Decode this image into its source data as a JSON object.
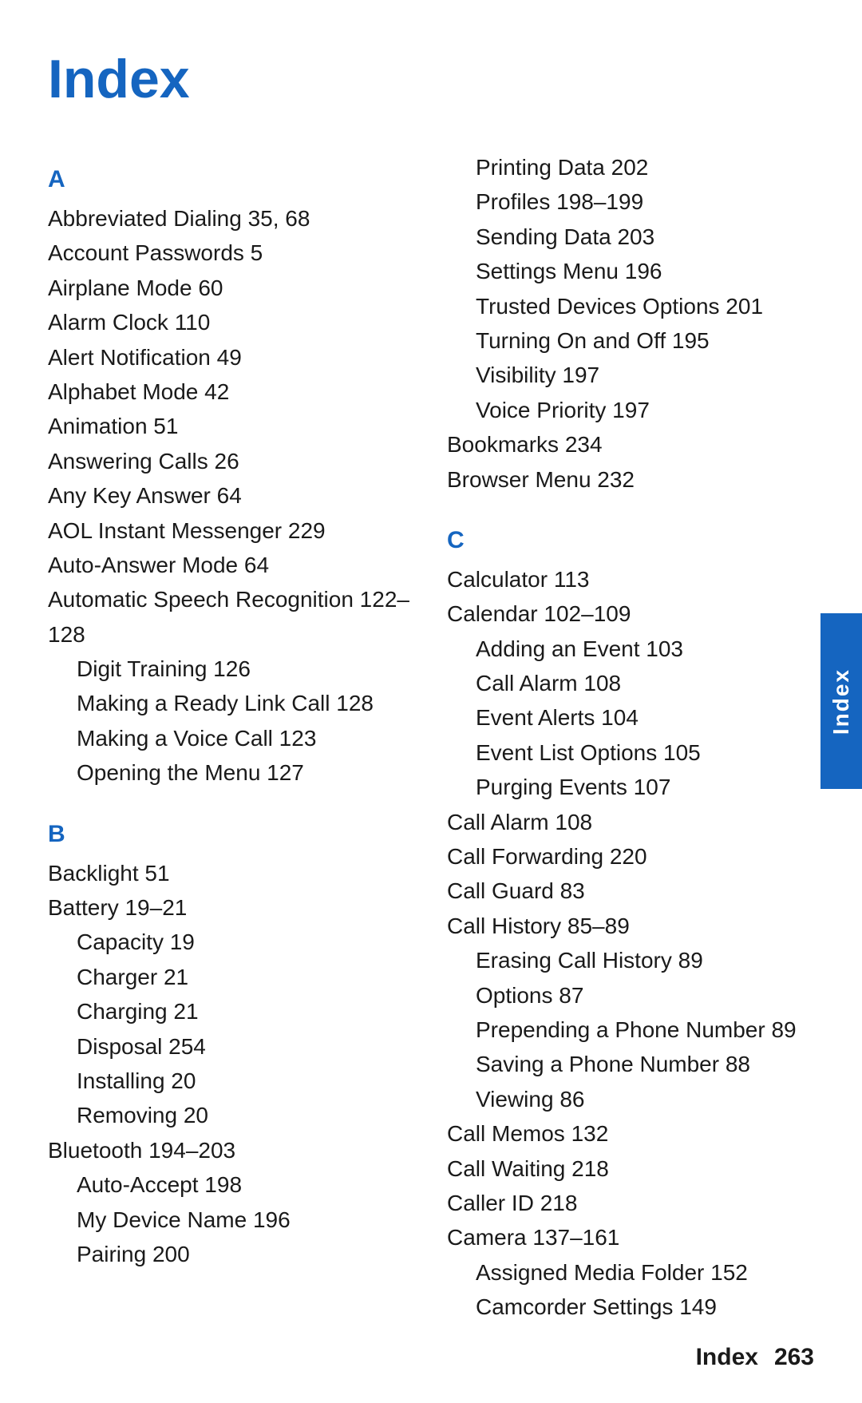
{
  "page": {
    "title": "Index",
    "footer_label": "Index",
    "footer_page": "263",
    "side_tab": "Index"
  },
  "left_column": {
    "sections": [
      {
        "letter": "A",
        "entries": [
          {
            "text": "Abbreviated Dialing  35, 68",
            "level": 0
          },
          {
            "text": "Account Passwords  5",
            "level": 0
          },
          {
            "text": "Airplane Mode  60",
            "level": 0
          },
          {
            "text": "Alarm Clock  110",
            "level": 0
          },
          {
            "text": "Alert Notification  49",
            "level": 0
          },
          {
            "text": "Alphabet Mode  42",
            "level": 0
          },
          {
            "text": "Animation  51",
            "level": 0
          },
          {
            "text": "Answering Calls  26",
            "level": 0
          },
          {
            "text": "Any Key Answer  64",
            "level": 0
          },
          {
            "text": "AOL Instant Messenger  229",
            "level": 0
          },
          {
            "text": "Auto-Answer Mode  64",
            "level": 0
          },
          {
            "text": "Automatic Speech Recognition  122–128",
            "level": 0
          },
          {
            "text": "Digit Training  126",
            "level": 1
          },
          {
            "text": "Making a Ready Link Call  128",
            "level": 1
          },
          {
            "text": "Making a Voice Call  123",
            "level": 1
          },
          {
            "text": "Opening the Menu  127",
            "level": 1
          }
        ]
      },
      {
        "letter": "B",
        "entries": [
          {
            "text": "Backlight  51",
            "level": 0
          },
          {
            "text": "Battery  19–21",
            "level": 0
          },
          {
            "text": "Capacity  19",
            "level": 1
          },
          {
            "text": "Charger  21",
            "level": 1
          },
          {
            "text": "Charging  21",
            "level": 1
          },
          {
            "text": "Disposal  254",
            "level": 1
          },
          {
            "text": "Installing  20",
            "level": 1
          },
          {
            "text": "Removing  20",
            "level": 1
          },
          {
            "text": "Bluetooth  194–203",
            "level": 0
          },
          {
            "text": "Auto-Accept  198",
            "level": 1
          },
          {
            "text": "My Device Name  196",
            "level": 1
          },
          {
            "text": "Pairing  200",
            "level": 1
          }
        ]
      }
    ]
  },
  "right_column": {
    "sections": [
      {
        "letter": "",
        "entries": [
          {
            "text": "Printing Data  202",
            "level": 1
          },
          {
            "text": "Profiles  198–199",
            "level": 1
          },
          {
            "text": "Sending Data  203",
            "level": 1
          },
          {
            "text": "Settings Menu  196",
            "level": 1
          },
          {
            "text": "Trusted Devices Options  201",
            "level": 1
          },
          {
            "text": "Turning On and Off  195",
            "level": 1
          },
          {
            "text": "Visibility  197",
            "level": 1
          },
          {
            "text": "Voice Priority  197",
            "level": 1
          },
          {
            "text": "Bookmarks  234",
            "level": 0
          },
          {
            "text": "Browser Menu  232",
            "level": 0
          }
        ]
      },
      {
        "letter": "C",
        "entries": [
          {
            "text": "Calculator  113",
            "level": 0
          },
          {
            "text": "Calendar  102–109",
            "level": 0
          },
          {
            "text": "Adding an Event  103",
            "level": 1
          },
          {
            "text": "Call Alarm  108",
            "level": 1
          },
          {
            "text": "Event Alerts  104",
            "level": 1
          },
          {
            "text": "Event List Options  105",
            "level": 1
          },
          {
            "text": "Purging Events  107",
            "level": 1
          },
          {
            "text": "Call Alarm  108",
            "level": 0
          },
          {
            "text": "Call Forwarding  220",
            "level": 0
          },
          {
            "text": "Call Guard  83",
            "level": 0
          },
          {
            "text": "Call History  85–89",
            "level": 0
          },
          {
            "text": "Erasing Call History  89",
            "level": 1
          },
          {
            "text": "Options  87",
            "level": 1
          },
          {
            "text": "Prepending a Phone Number  89",
            "level": 1
          },
          {
            "text": "Saving a Phone Number  88",
            "level": 1
          },
          {
            "text": "Viewing  86",
            "level": 1
          },
          {
            "text": "Call Memos  132",
            "level": 0
          },
          {
            "text": "Call Waiting  218",
            "level": 0
          },
          {
            "text": "Caller ID  218",
            "level": 0
          },
          {
            "text": "Camera  137–161",
            "level": 0
          },
          {
            "text": "Assigned Media Folder  152",
            "level": 1
          },
          {
            "text": "Camcorder Settings  149",
            "level": 1
          }
        ]
      }
    ]
  }
}
